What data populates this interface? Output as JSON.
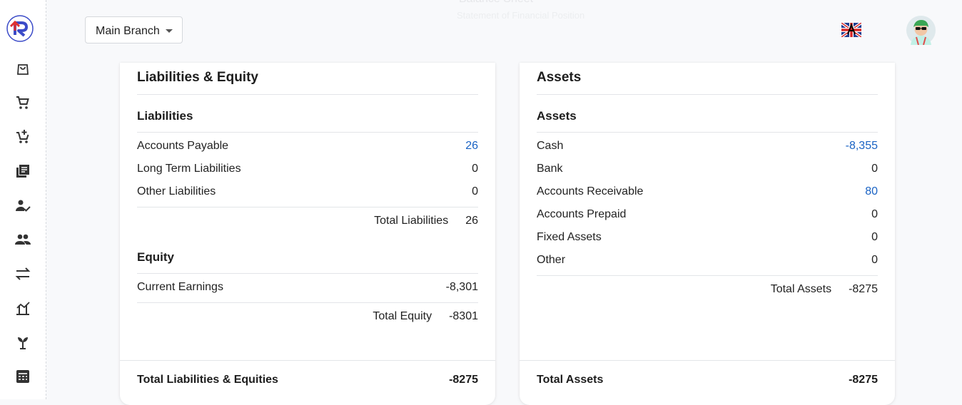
{
  "header": {
    "branch": "Main Branch",
    "ghost_title": "Balance Sheet",
    "ghost_subtitle": "Statement of Financial Position"
  },
  "sidebar": {
    "icons": [
      "logo",
      "bag-icon",
      "cart-icon",
      "cart-plus-icon",
      "receipt-icon",
      "person-check-icon",
      "people-icon",
      "transfer-icon",
      "chart-icon",
      "plant-icon",
      "calculator-icon"
    ]
  },
  "liabilities_equity": {
    "title": "Liabilities & Equity",
    "liabilities": {
      "heading": "Liabilities",
      "rows": [
        {
          "label": "Accounts Payable",
          "value": "26"
        },
        {
          "label": "Long Term Liabilities",
          "value": "0"
        },
        {
          "label": "Other Liabilities",
          "value": "0"
        }
      ],
      "total_label": "Total Liabilities",
      "total_value": "26"
    },
    "equity": {
      "heading": "Equity",
      "rows": [
        {
          "label": "Current Earnings",
          "value": "-8,301"
        }
      ],
      "total_label": "Total Equity",
      "total_value": "-8301"
    },
    "footer_label": "Total Liabilities & Equities",
    "footer_value": "-8275"
  },
  "assets": {
    "title": "Assets",
    "heading": "Assets",
    "rows": [
      {
        "label": "Cash",
        "value": "-8,355"
      },
      {
        "label": "Bank",
        "value": "0"
      },
      {
        "label": "Accounts Receivable",
        "value": "80"
      },
      {
        "label": "Accounts Prepaid",
        "value": "0"
      },
      {
        "label": "Fixed Assets",
        "value": "0"
      },
      {
        "label": "Other",
        "value": "0"
      }
    ],
    "total_label": "Total Assets",
    "total_value": "-8275",
    "footer_label": "Total Assets",
    "footer_value": "-8275"
  },
  "colors": {
    "link": "#1a63c4",
    "brand_blue": "#3b5bdb",
    "brand_red": "#e03131"
  }
}
